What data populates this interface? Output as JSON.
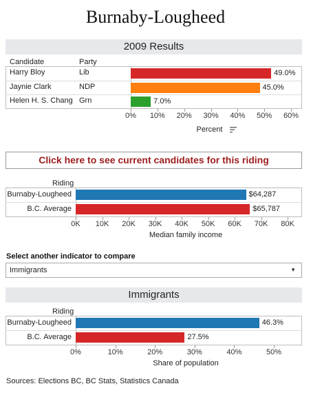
{
  "page": {
    "title": "Burnaby-Lougheed"
  },
  "results": {
    "band_title": "2009 Results",
    "col_candidate": "Candidate",
    "col_party": "Party",
    "axis_title": "Percent",
    "sort_icon": "sort-icon",
    "ticks": [
      "0%",
      "10%",
      "20%",
      "30%",
      "40%",
      "50%",
      "60%"
    ]
  },
  "cta": {
    "label": "Click here to see current candidates for this riding"
  },
  "income": {
    "row_header": "Riding",
    "axis_title": "Median family income",
    "ticks": [
      "0K",
      "10K",
      "20K",
      "30K",
      "40K",
      "50K",
      "60K",
      "70K",
      "80K"
    ]
  },
  "selector": {
    "label": "Select another indicator to compare",
    "selected": "Immigrants",
    "arrow_icon": "dropdown-arrow-icon"
  },
  "immigrants": {
    "band_title": "Immigrants",
    "row_header": "Riding",
    "axis_title": "Share of population",
    "ticks": [
      "0%",
      "10%",
      "20%",
      "30%",
      "40%",
      "50%"
    ]
  },
  "footer": {
    "sources": "Sources: Elections BC, BC Stats, Statistics Canada"
  },
  "colors": {
    "blue": "#1f77b4",
    "red": "#d62728",
    "orange": "#ff7f0e",
    "green": "#2ca02c"
  },
  "chart_data": [
    {
      "type": "bar",
      "orientation": "horizontal",
      "title": "2009 Results",
      "xlabel": "Percent",
      "xlim": [
        0,
        60
      ],
      "categories": [
        "Harry Bloy",
        "Jaynie Clark",
        "Helen H. S. Chang"
      ],
      "parties": [
        "Lib",
        "NDP",
        "Grn"
      ],
      "values": [
        49.0,
        45.0,
        7.0
      ],
      "value_labels": [
        "49.0%",
        "45.0%",
        "7.0%"
      ],
      "bar_colors": [
        "#d62728",
        "#ff7f0e",
        "#2ca02c"
      ]
    },
    {
      "type": "bar",
      "orientation": "horizontal",
      "xlabel": "Median family income",
      "xlim": [
        0,
        80000
      ],
      "categories": [
        "Burnaby-Lougheed",
        "B.C. Average"
      ],
      "values": [
        64287,
        65787
      ],
      "value_labels": [
        "$64,287",
        "$65,787"
      ],
      "bar_colors": [
        "#1f77b4",
        "#d62728"
      ]
    },
    {
      "type": "bar",
      "orientation": "horizontal",
      "title": "Immigrants",
      "xlabel": "Share of population",
      "xlim": [
        0,
        50
      ],
      "categories": [
        "Burnaby-Lougheed",
        "B.C. Average"
      ],
      "values": [
        46.3,
        27.5
      ],
      "value_labels": [
        "46.3%",
        "27.5%"
      ],
      "bar_colors": [
        "#1f77b4",
        "#d62728"
      ]
    }
  ]
}
